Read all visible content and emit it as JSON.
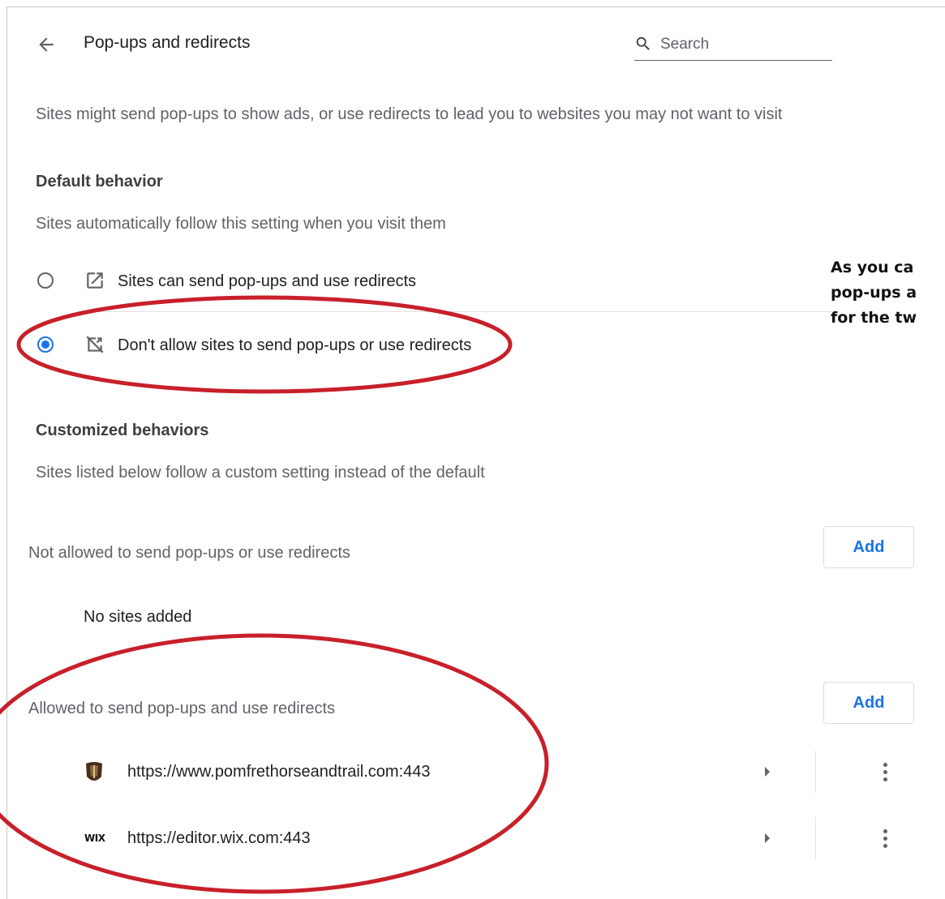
{
  "header": {
    "title": "Pop-ups and redirects",
    "search_placeholder": "Search"
  },
  "description": "Sites might send pop-ups to show ads, or use redirects to lead you to websites you may not want to visit",
  "default_behavior": {
    "heading": "Default behavior",
    "subtext": "Sites automatically follow this setting when you visit them",
    "options": [
      {
        "label": "Sites can send pop-ups and use redirects",
        "selected": false,
        "icon": "open-in-new-icon"
      },
      {
        "label": "Don't allow sites to send pop-ups or use redirects",
        "selected": true,
        "icon": "block-popup-icon"
      }
    ]
  },
  "customized_behaviors": {
    "heading": "Customized behaviors",
    "subtext": "Sites listed below follow a custom setting instead of the default"
  },
  "not_allowed": {
    "label": "Not allowed to send pop-ups or use redirects",
    "add_label": "Add",
    "empty_text": "No sites added"
  },
  "allowed": {
    "label": "Allowed to send pop-ups and use redirects",
    "add_label": "Add",
    "sites": [
      {
        "url": "https://www.pomfrethorseandtrail.com:443",
        "favicon": "horseshoe-favicon"
      },
      {
        "url": "https://editor.wix.com:443",
        "favicon": "wix-favicon",
        "favicon_text": "WIX"
      }
    ]
  },
  "annotation": {
    "lines": [
      "As you ca",
      "pop-ups a",
      "for the tw"
    ]
  },
  "colors": {
    "accent": "#1a73e8",
    "annotation_ellipse": "#c8202a",
    "text_secondary": "#5f6368"
  }
}
